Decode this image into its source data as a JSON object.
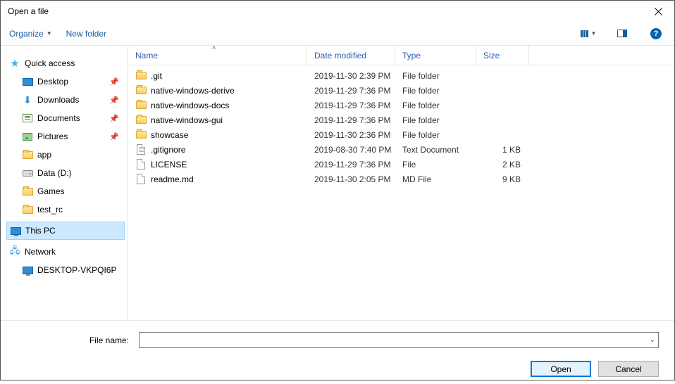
{
  "window": {
    "title": "Open a file"
  },
  "toolbar": {
    "organize": "Organize",
    "new_folder": "New folder"
  },
  "sidebar": {
    "quick_access": "Quick access",
    "items": [
      {
        "label": "Desktop",
        "pinned": true
      },
      {
        "label": "Downloads",
        "pinned": true
      },
      {
        "label": "Documents",
        "pinned": true
      },
      {
        "label": "Pictures",
        "pinned": true
      },
      {
        "label": "app",
        "pinned": false
      },
      {
        "label": "Data (D:)",
        "pinned": false
      },
      {
        "label": "Games",
        "pinned": false
      },
      {
        "label": "test_rc",
        "pinned": false
      }
    ],
    "this_pc": "This PC",
    "network": "Network",
    "network_items": [
      {
        "label": "DESKTOP-VKPQI6P"
      }
    ]
  },
  "columns": {
    "name": "Name",
    "date": "Date modified",
    "type": "Type",
    "size": "Size"
  },
  "files": [
    {
      "icon": "folder",
      "name": ".git",
      "date": "2019-11-30 2:39 PM",
      "type": "File folder",
      "size": ""
    },
    {
      "icon": "folder",
      "name": "native-windows-derive",
      "date": "2019-11-29 7:36 PM",
      "type": "File folder",
      "size": ""
    },
    {
      "icon": "folder",
      "name": "native-windows-docs",
      "date": "2019-11-29 7:36 PM",
      "type": "File folder",
      "size": ""
    },
    {
      "icon": "folder",
      "name": "native-windows-gui",
      "date": "2019-11-29 7:36 PM",
      "type": "File folder",
      "size": ""
    },
    {
      "icon": "folder",
      "name": "showcase",
      "date": "2019-11-30 2:36 PM",
      "type": "File folder",
      "size": ""
    },
    {
      "icon": "txt",
      "name": ".gitignore",
      "date": "2019-08-30 7:40 PM",
      "type": "Text Document",
      "size": "1 KB"
    },
    {
      "icon": "file",
      "name": "LICENSE",
      "date": "2019-11-29 7:36 PM",
      "type": "File",
      "size": "2 KB"
    },
    {
      "icon": "file",
      "name": "readme.md",
      "date": "2019-11-30 2:05 PM",
      "type": "MD File",
      "size": "9 KB"
    }
  ],
  "bottom": {
    "filename_label": "File name:",
    "filename_value": "",
    "open": "Open",
    "cancel": "Cancel"
  }
}
